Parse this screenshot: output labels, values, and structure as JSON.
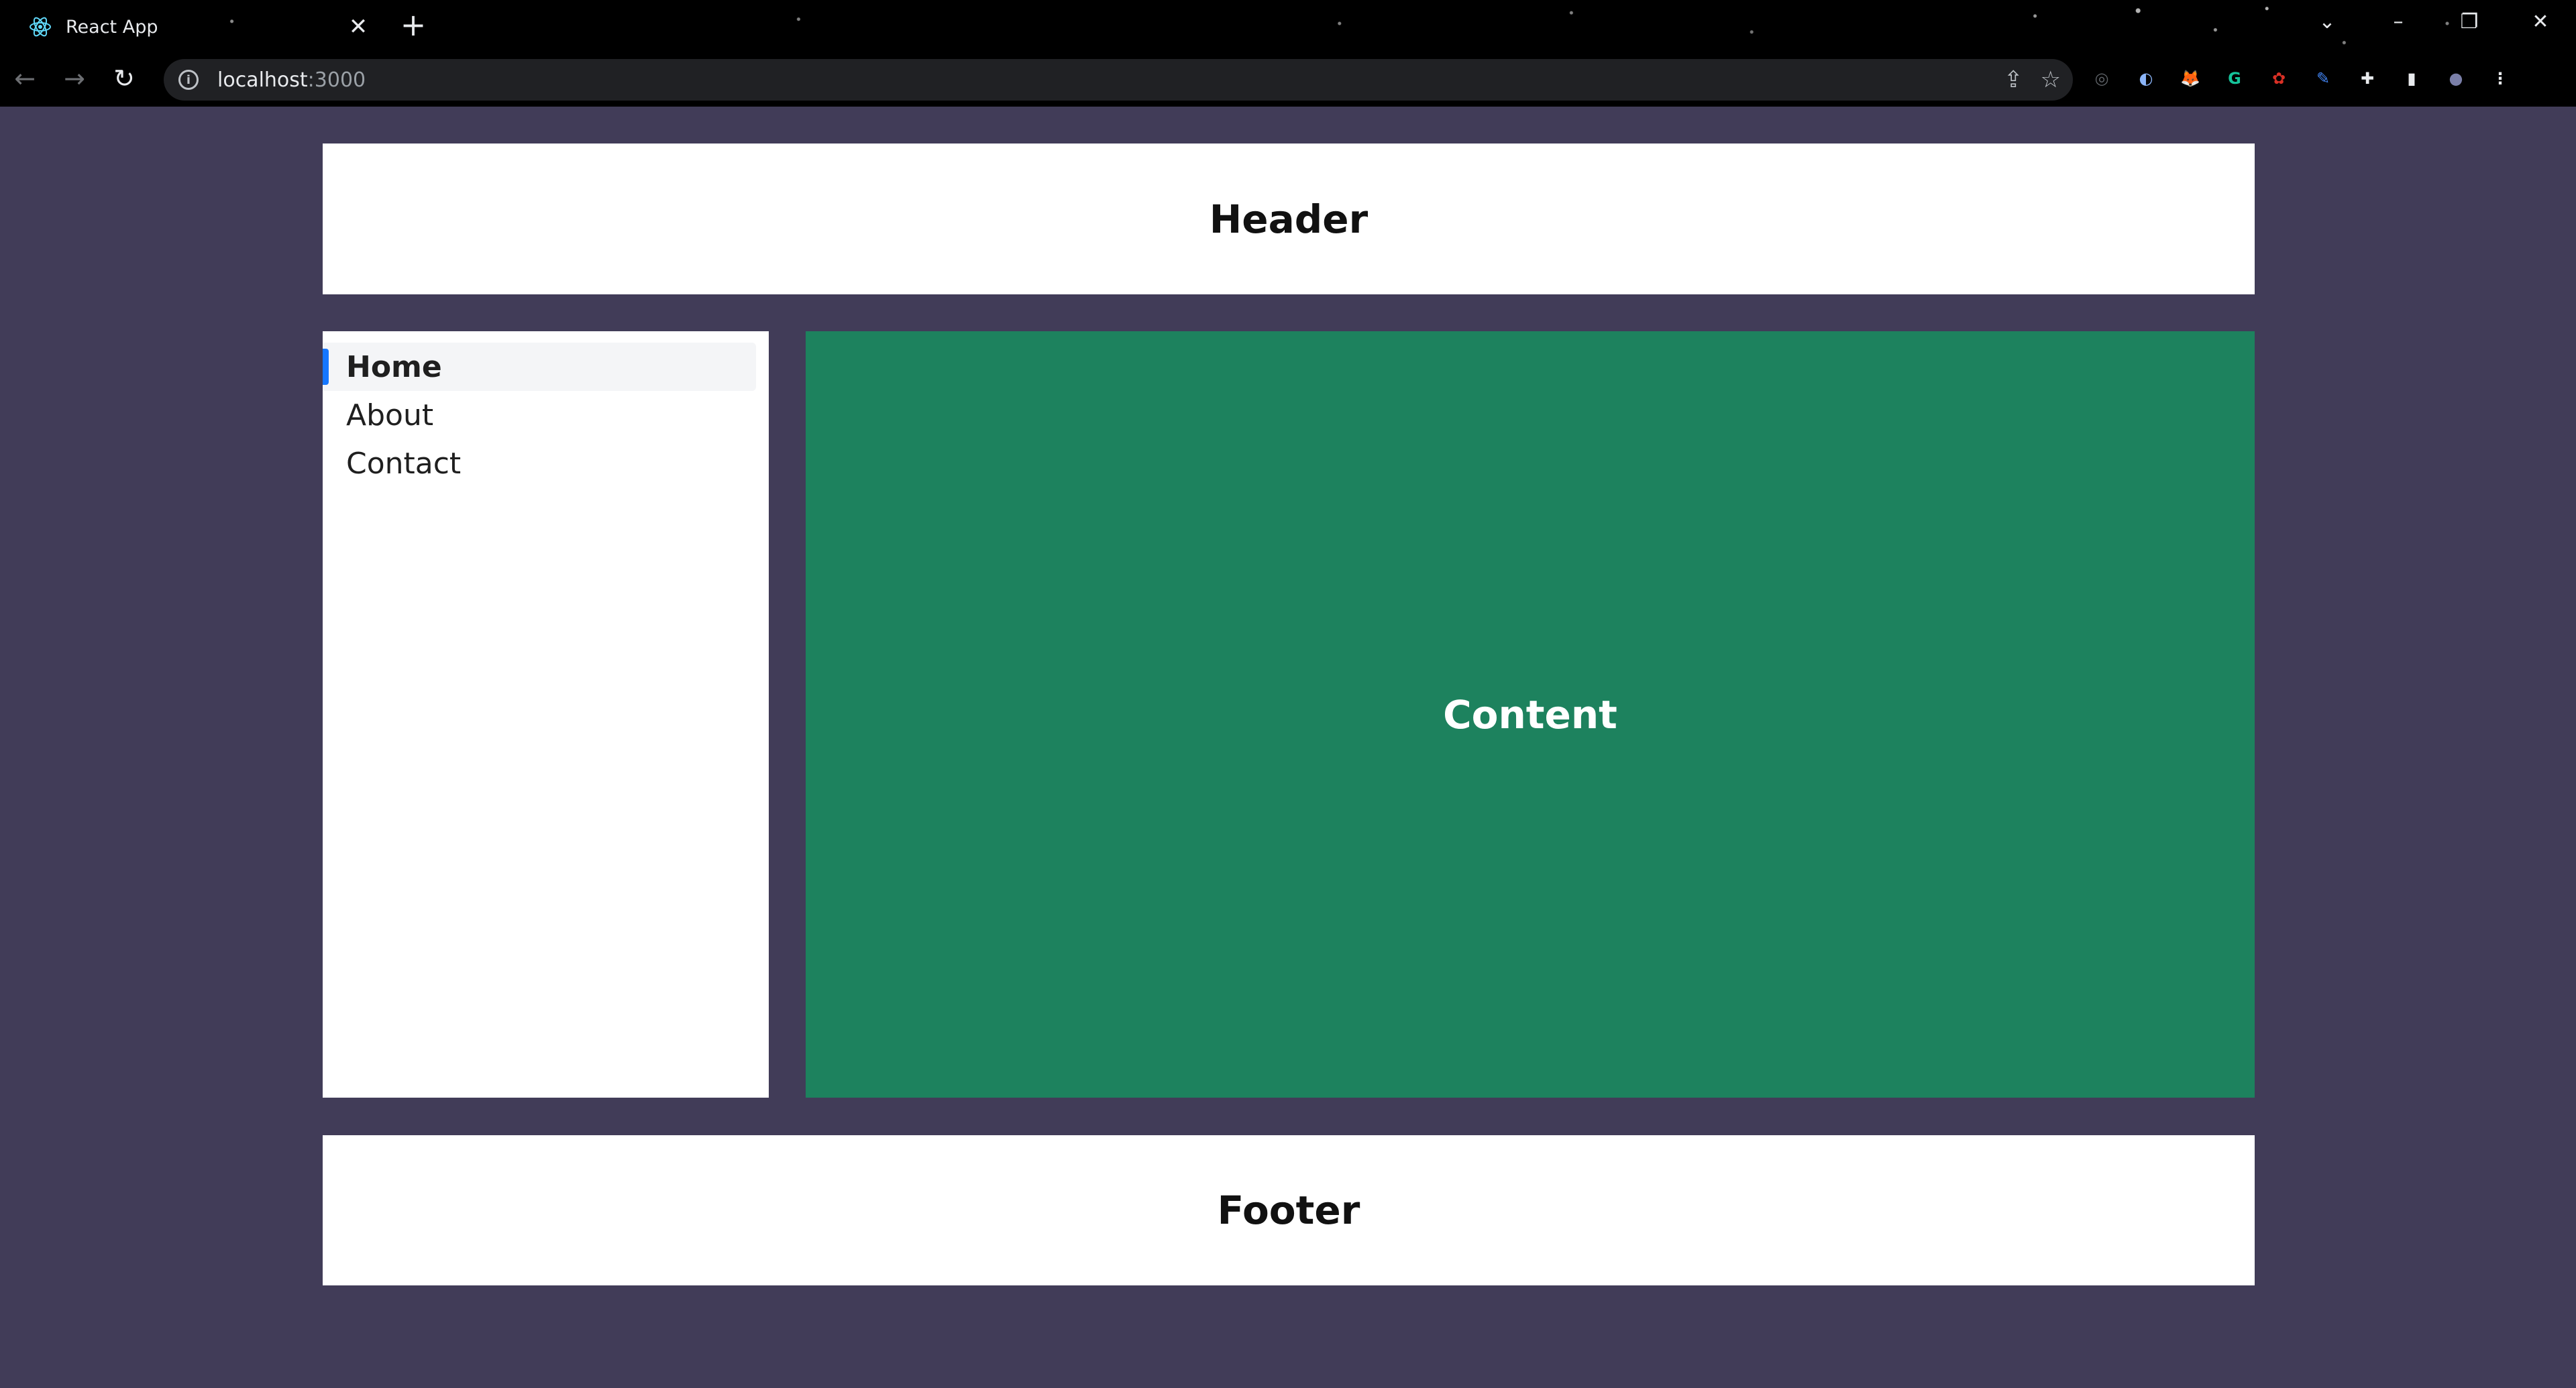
{
  "browser": {
    "tab": {
      "title": "React App",
      "favicon": "react-logo-icon",
      "close_glyph": "✕"
    },
    "new_tab_glyph": "+",
    "window_controls": {
      "dropdown": "⌄",
      "minimize": "–",
      "restore": "❐",
      "close": "✕"
    },
    "nav": {
      "back": "←",
      "forward": "→",
      "reload": "↻"
    },
    "address": {
      "host": "localhost",
      "port": ":3000",
      "info_glyph": "i"
    },
    "omnibox_icons": {
      "share": "⇪",
      "bookmark": "☆"
    },
    "extensions": [
      {
        "name": "target-extension-icon",
        "glyph": "◎",
        "color": "#5f6368"
      },
      {
        "name": "shield-extension-icon",
        "glyph": "◐",
        "color": "#8ab4f8"
      },
      {
        "name": "metamask-extension-icon",
        "glyph": "🦊",
        "color": "#e2761b"
      },
      {
        "name": "grammarly-extension-icon",
        "glyph": "G",
        "color": "#15c39a"
      },
      {
        "name": "red-extension-icon",
        "glyph": "✿",
        "color": "#d93025"
      },
      {
        "name": "pen-extension-icon",
        "glyph": "✎",
        "color": "#4285f4"
      },
      {
        "name": "puzzle-extensions-icon",
        "glyph": "✚",
        "color": "#e8eaed"
      },
      {
        "name": "side-panel-icon",
        "glyph": "▮",
        "color": "#e8eaed"
      },
      {
        "name": "profile-avatar-icon",
        "glyph": "●",
        "color": "#7a7fa8"
      },
      {
        "name": "more-menu-icon",
        "glyph": "⋮",
        "color": "#e8eaed"
      }
    ]
  },
  "layout": {
    "header": "Header",
    "menu": [
      {
        "label": "Home",
        "active": true
      },
      {
        "label": "About",
        "active": false
      },
      {
        "label": "Contact",
        "active": false
      }
    ],
    "content": "Content",
    "footer": "Footer"
  },
  "colors": {
    "page_bg": "#413c58",
    "content_bg": "#1d825e",
    "menu_active_indicator": "#1677ff"
  }
}
